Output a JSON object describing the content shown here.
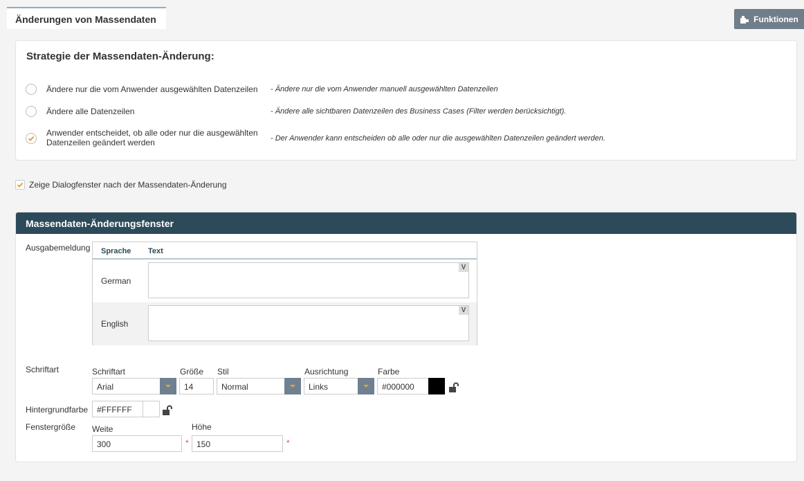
{
  "tab": {
    "title": "Änderungen von Massendaten"
  },
  "toolbar": {
    "functions_label": "Funktionen"
  },
  "strategy": {
    "title": "Strategie der Massendaten-Änderung:",
    "options": [
      {
        "label": "Ändere nur die vom Anwender ausgewählten Datenzeilen",
        "description": "- Ändere nur die vom Anwender manuell ausgewählten Datenzeilen",
        "selected": false
      },
      {
        "label": "Ändere alle Datenzeilen",
        "description": "- Ändere alle sichtbaren Datenzeilen des Business Cases (Filter werden berücksichtigt).",
        "selected": false
      },
      {
        "label": "Anwender entscheidet, ob alle oder nur die ausgewählten Datenzeilen geändert werden",
        "description": "- Der Anwender kann entscheiden ob alle oder nur die ausgewählten Datenzeilen geändert werden.",
        "selected": true
      }
    ]
  },
  "show_dialog": {
    "label": "Zeige Dialogfenster nach der Massendaten-Änderung",
    "checked": true
  },
  "window_section": {
    "title": "Massendaten-Änderungsfenster",
    "output_label": "Ausgabemeldung",
    "grid": {
      "col_language": "Sprache",
      "col_text": "Text",
      "rows": [
        {
          "language": "German",
          "text": "",
          "v_label": "V"
        },
        {
          "language": "English",
          "text": "",
          "v_label": "V"
        }
      ]
    },
    "font": {
      "label": "Schriftart",
      "font_label": "Schriftart",
      "font_value": "Arial",
      "size_label": "Größe",
      "size_value": "14",
      "style_label": "Stil",
      "style_value": "Normal",
      "align_label": "Ausrichtung",
      "align_value": "Links",
      "color_label": "Farbe",
      "color_value": "#000000"
    },
    "background": {
      "label": "Hintergrundfarbe",
      "value": "#FFFFFF"
    },
    "size": {
      "label": "Fenstergröße",
      "width_label": "Weite",
      "width_value": "300",
      "height_label": "Höhe",
      "height_value": "150",
      "required_mark": "*"
    }
  },
  "colors": {
    "header_bg": "#2c4a5a",
    "accent": "#e6a23c",
    "button_bg": "#6f7e8a",
    "swatch": "#000000"
  }
}
